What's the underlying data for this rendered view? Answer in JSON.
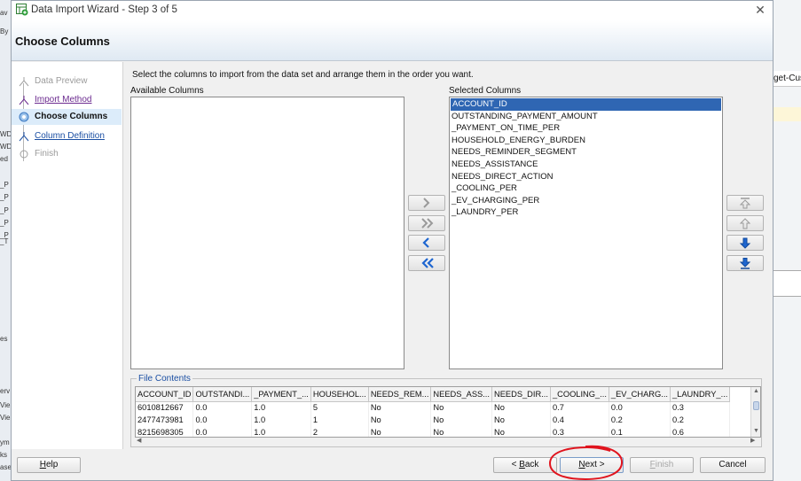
{
  "window": {
    "title": "Data Import Wizard - Step 3 of 5",
    "header_title": "Choose Columns"
  },
  "background_app": {
    "left_fragments": [
      "av",
      "By",
      "WD",
      "WD",
      "ed",
      "_P",
      "_P",
      "_P",
      "_P",
      "_P",
      "_T",
      "es",
      "erv",
      "Vie",
      "Vie",
      "ym",
      "ks",
      "ase"
    ],
    "right_tab": "get-Cust"
  },
  "steps": [
    {
      "label": "Data Preview",
      "state": "disabled"
    },
    {
      "label": "Import Method",
      "state": "visited"
    },
    {
      "label": "Choose Columns",
      "state": "current"
    },
    {
      "label": "Column Definition",
      "state": "link"
    },
    {
      "label": "Finish",
      "state": "disabled"
    }
  ],
  "instructions": "Select the columns to import from the data set and arrange them in the order you want.",
  "available_columns": {
    "label": "Available Columns",
    "items": []
  },
  "selected_columns": {
    "label": "Selected Columns",
    "items": [
      "ACCOUNT_ID",
      "OUTSTANDING_PAYMENT_AMOUNT",
      "_PAYMENT_ON_TIME_PER",
      "HOUSEHOLD_ENERGY_BURDEN",
      "NEEDS_REMINDER_SEGMENT",
      "NEEDS_ASSISTANCE",
      "NEEDS_DIRECT_ACTION",
      "_COOLING_PER",
      "_EV_CHARGING_PER",
      "_LAUNDRY_PER"
    ],
    "selected_index": 0
  },
  "move_buttons": {
    "middle": [
      "move-right-icon",
      "move-all-right-icon",
      "move-left-icon",
      "move-all-left-icon"
    ],
    "right": [
      "move-top-icon",
      "move-up-icon",
      "move-down-icon",
      "move-bottom-icon"
    ]
  },
  "file_contents": {
    "label": "File Contents",
    "headers": [
      "ACCOUNT_ID",
      "OUTSTANDI...",
      "_PAYMENT_...",
      "HOUSEHOL...",
      "NEEDS_REM...",
      "NEEDS_ASS...",
      "NEEDS_DIR...",
      "_COOLING_...",
      "_EV_CHARG...",
      "_LAUNDRY_..."
    ],
    "rows": [
      [
        "6010812667",
        "0.0",
        "1.0",
        "5",
        "No",
        "No",
        "No",
        "0.7",
        "0.0",
        "0.3"
      ],
      [
        "2477473981",
        "0.0",
        "1.0",
        "1",
        "No",
        "No",
        "No",
        "0.4",
        "0.2",
        "0.2"
      ],
      [
        "8215698305",
        "0.0",
        "1.0",
        "2",
        "No",
        "No",
        "No",
        "0.3",
        "0.1",
        "0.6"
      ]
    ]
  },
  "buttons": {
    "help": "Help",
    "back": "< Back",
    "next": "Next >",
    "finish": "Finish",
    "cancel": "Cancel"
  },
  "colors": {
    "selection": "#2f66b3",
    "annotation_circle": "#e0141e",
    "link": "#1b4fa3"
  }
}
